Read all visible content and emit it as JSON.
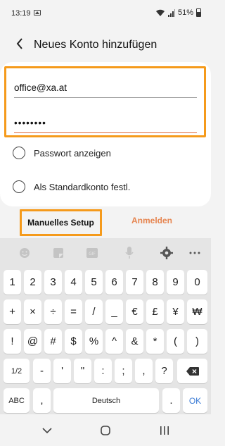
{
  "status_bar": {
    "time": "13:19",
    "battery": "51%"
  },
  "header": {
    "title": "Neues Konto hinzufügen"
  },
  "form": {
    "email_value": "office@xa.at",
    "password_value": "••••••••",
    "show_password_label": "Passwort anzeigen",
    "default_account_label": "Als Standardkonto festl."
  },
  "actions": {
    "manual_setup": "Manuelles Setup",
    "login": "Anmelden"
  },
  "keyboard": {
    "row1": [
      "1",
      "2",
      "3",
      "4",
      "5",
      "6",
      "7",
      "8",
      "9",
      "0"
    ],
    "row2": [
      "+",
      "×",
      "÷",
      "=",
      "/",
      "_",
      "€",
      "£",
      "¥",
      "₩"
    ],
    "row3": [
      "!",
      "@",
      "#",
      "$",
      "%",
      "^",
      "&",
      "*",
      "(",
      ")"
    ],
    "row4": [
      "1/2",
      "-",
      "'",
      "\"",
      ":",
      ";",
      ",",
      "?"
    ],
    "row5_left": "ABC",
    "row5_space": "Deutsch",
    "row5_comma": ",",
    "row5_dot": ".",
    "row5_ok": "OK"
  },
  "colors": {
    "highlight": "#f59a1b",
    "accent": "#e68550",
    "ok": "#3a7bd5"
  }
}
